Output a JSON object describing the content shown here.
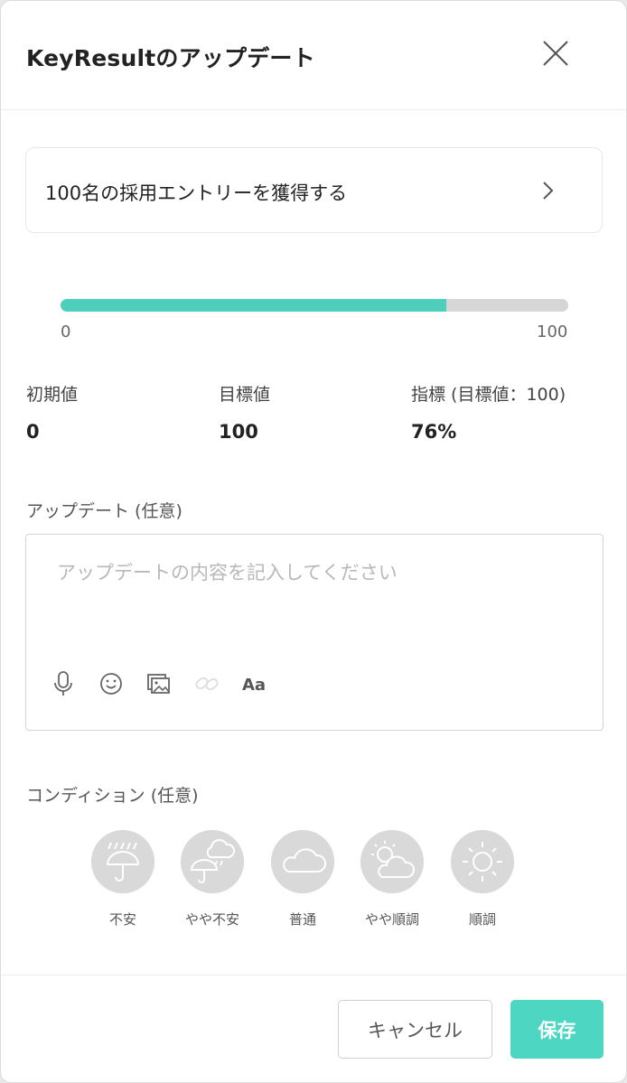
{
  "modal": {
    "title": "KeyResultのアップデート"
  },
  "key_result": {
    "name": "100名の採用エントリーを獲得する"
  },
  "progress": {
    "min_label": "0",
    "max_label": "100",
    "fraction": 0.76,
    "fill_color": "#4dcfbc"
  },
  "stats": [
    {
      "label": "初期値",
      "value": "0"
    },
    {
      "label": "目標値",
      "value": "100"
    },
    {
      "label": "指標 (目標値：100)",
      "value": "76%"
    }
  ],
  "update": {
    "label": "アップデート (任意)",
    "placeholder": "アップデートの内容を記入してください",
    "tools": [
      {
        "icon": "microphone-icon"
      },
      {
        "icon": "emoji-icon"
      },
      {
        "icon": "image-icon"
      },
      {
        "icon": "link-icon"
      },
      {
        "icon": "text-format-icon",
        "text": "Aa"
      }
    ]
  },
  "condition": {
    "label": "コンディション (任意)",
    "options": [
      {
        "label": "不安",
        "icon": "rain-umbrella-icon"
      },
      {
        "label": "やや不安",
        "icon": "cloud-rain-umbrella-icon"
      },
      {
        "label": "普通",
        "icon": "cloud-icon"
      },
      {
        "label": "やや順調",
        "icon": "sun-cloud-icon"
      },
      {
        "label": "順調",
        "icon": "sun-icon"
      }
    ]
  },
  "footer": {
    "cancel_label": "キャンセル",
    "save_label": "保存",
    "accent_color": "#4dd6c1"
  }
}
